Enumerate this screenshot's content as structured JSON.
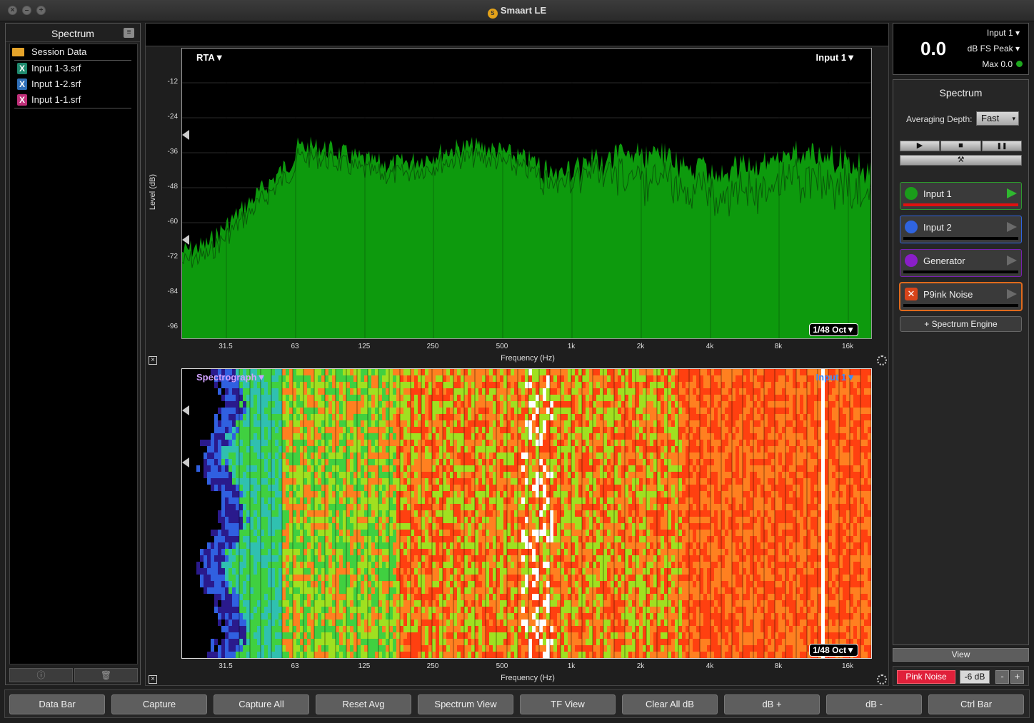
{
  "window": {
    "title": "Smaart LE"
  },
  "left": {
    "title": "Spectrum",
    "session_label": "Session Data",
    "files": [
      {
        "name": "Input 1-3.srf",
        "color": "#1f8a6e"
      },
      {
        "name": "Input 1-2.srf",
        "color": "#2f6fb8"
      },
      {
        "name": "Input 1-1.srf",
        "color": "#c0307a"
      }
    ],
    "foot_info": "ⓘ",
    "foot_trash": "🗑"
  },
  "rta": {
    "tag": "RTA▼",
    "input": "Input 1▼",
    "oct": "1/48 Oct▼",
    "ylabel": "Level (dB)",
    "xlabel": "Frequency (Hz)",
    "yticks": [
      "-12",
      "-24",
      "-36",
      "-48",
      "-60",
      "-72",
      "-84",
      "-96"
    ],
    "xticks": [
      "31.5",
      "63",
      "125",
      "250",
      "500",
      "1k",
      "2k",
      "4k",
      "8k",
      "16k"
    ],
    "fill_color": "#0d9a0d"
  },
  "spectrograph": {
    "tag": "Spectrograph▼",
    "input": "Input 1▼",
    "oct": "1/48 Oct▼",
    "xlabel": "Frequency (Hz)",
    "xticks": [
      "31.5",
      "63",
      "125",
      "250",
      "500",
      "1k",
      "2k",
      "4k",
      "8k",
      "16k"
    ]
  },
  "meter": {
    "input": "Input 1",
    "value": "0.0",
    "units": "dB FS Peak",
    "max": "Max 0.0"
  },
  "control": {
    "title": "Spectrum",
    "avg_label": "Averaging Depth:",
    "avg_value": "Fast",
    "play": "▶",
    "stop": "■",
    "pause": "❚❚",
    "tools": "⚒",
    "engines": [
      {
        "name": "Input 1",
        "dot": "#1a9c1a",
        "border": "#2d9b2d",
        "bar": "#e01010",
        "play": "#2fb82f"
      },
      {
        "name": "Input 2",
        "dot": "#2f64e0",
        "border": "#2f64e0",
        "bar": "#000",
        "play": "#6a6a6a"
      },
      {
        "name": "Generator",
        "dot": "#8a1ec8",
        "border": "#7a1fb0",
        "bar": "#000",
        "play": "#6a6a6a"
      },
      {
        "name": "P9ink Noise",
        "dot": "#d7441a",
        "border": "#e06a1c",
        "bar": "#000",
        "play": "#6a6a6a"
      }
    ],
    "add_engine": "+ Spectrum Engine",
    "view": "View",
    "gen_label": "Pink Noise",
    "gen_level": "-6 dB",
    "minus": "-",
    "plus": "+"
  },
  "bottom_buttons": [
    "Data Bar",
    "Capture",
    "Capture All",
    "Reset Avg",
    "Spectrum View",
    "TF View",
    "Clear All dB",
    "dB +",
    "dB -",
    "Ctrl Bar"
  ]
}
